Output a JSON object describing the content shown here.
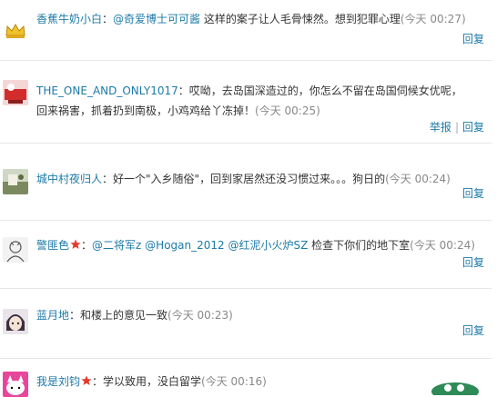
{
  "comments": [
    {
      "name": "香蕉牛奶小白",
      "segments": [
        {
          "type": "mention",
          "text": "@奇爱博士可可酱"
        },
        {
          "type": "text",
          "text": " 这样的案子让人毛骨悚然。想到犯罪心理"
        }
      ],
      "time": "(今天 00:27)",
      "reply": "回复"
    },
    {
      "name": "THE_ONE_AND_ONLY1017",
      "segments": [
        {
          "type": "text",
          "text": "哎呦，去岛国深造过的，你怎么不留在岛国伺候女优呢，"
        },
        {
          "type": "text",
          "text": "回来祸害，抓着扔到南极，小鸡鸡给丫冻掉！"
        }
      ],
      "time": "(今天 00:25)",
      "report": "举报",
      "reply": "回复"
    },
    {
      "name": "城中村夜归人",
      "segments": [
        {
          "type": "text",
          "text": "好一个\"入乡随俗\"，回到家居然还没习惯过来。。。狗日的"
        }
      ],
      "time": "(今天 00:24)",
      "reply": "回复"
    },
    {
      "name": "警匪色",
      "segments": [
        {
          "type": "mention",
          "text": "@二将军z"
        },
        {
          "type": "text",
          "text": " "
        },
        {
          "type": "mention",
          "text": "@Hogan_2012"
        },
        {
          "type": "text",
          "text": " "
        },
        {
          "type": "mention",
          "text": "@红泥小火炉SZ"
        },
        {
          "type": "text",
          "text": " 检查下你们的地下室"
        }
      ],
      "time": "(今天 00:24)",
      "reply": "回复"
    },
    {
      "name": "蓝月地",
      "segments": [
        {
          "type": "text",
          "text": "和楼上的意见一致"
        }
      ],
      "time": "(今天 00:23)",
      "reply": "回复"
    },
    {
      "name": "我是刘钧",
      "segments": [
        {
          "type": "text",
          "text": "学以致用，没白留学"
        }
      ],
      "time": "(今天 00:16)"
    }
  ],
  "colors": {
    "link": "#1d7aa8",
    "time": "#888888",
    "divider": "#e6e6e6",
    "badge_star": "#e23b2e"
  }
}
